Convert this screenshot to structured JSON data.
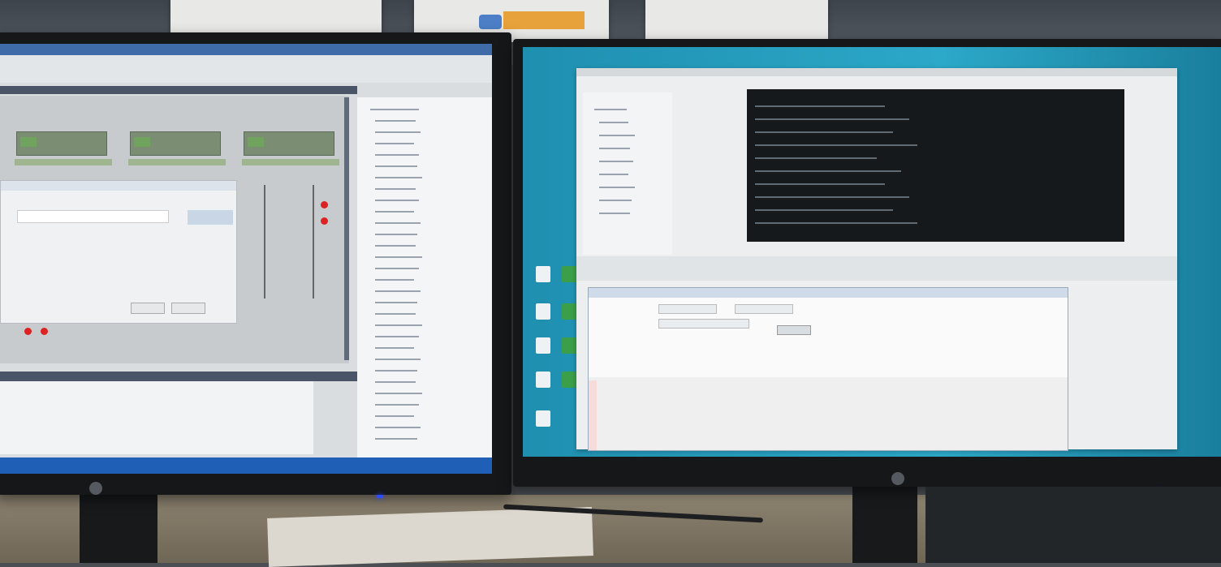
{
  "scene": {
    "description_tags": [
      "two-monitors",
      "office-desk"
    ]
  },
  "left_monitor": {
    "taskbar_clock": "",
    "colors": {
      "titlebar": "#3f6ca8",
      "taskbar": "#1f5fb6"
    }
  },
  "right_monitor": {
    "colors": {
      "desktop": "#2ca8c8",
      "console": "#16191c"
    }
  }
}
